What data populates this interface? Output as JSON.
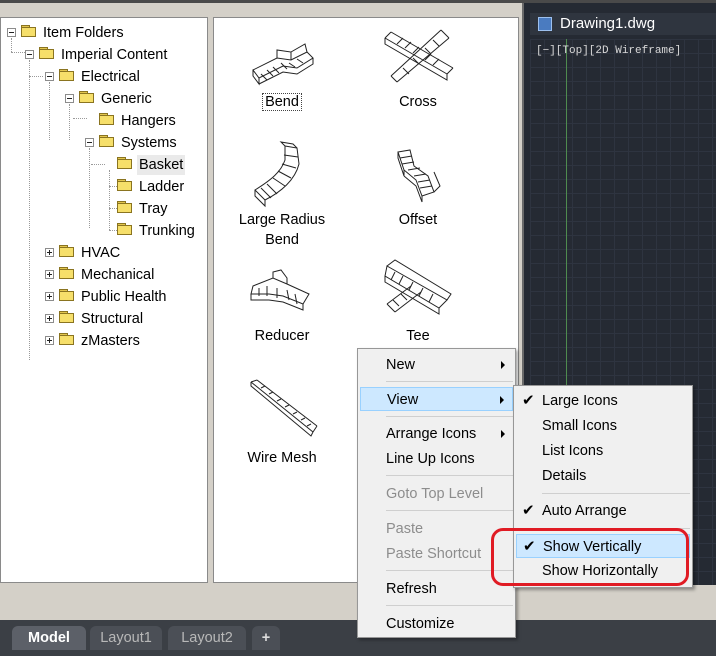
{
  "tree": {
    "root": "Item Folders",
    "imperial": "Imperial Content",
    "electrical": "Electrical",
    "generic": "Generic",
    "hangers": "Hangers",
    "systems": "Systems",
    "basket": "Basket",
    "ladder": "Ladder",
    "tray": "Tray",
    "trunking": "Trunking",
    "hvac": "HVAC",
    "mechanical": "Mechanical",
    "public_health": "Public Health",
    "structural": "Structural",
    "zmasters": "zMasters"
  },
  "icons": {
    "bend": "Bend",
    "cross": "Cross",
    "large_radius_bend_1": "Large Radius",
    "large_radius_bend_2": "Bend",
    "offset": "Offset",
    "reducer": "Reducer",
    "tee": "Tee",
    "wire_mesh": "Wire Mesh"
  },
  "drawing": {
    "tab_title": "Drawing1.dwg",
    "viewport_label": "[−][Top][2D Wireframe]"
  },
  "layout_tabs": {
    "model": "Model",
    "layout1": "Layout1",
    "layout2": "Layout2",
    "add": "+"
  },
  "context_menu": {
    "new": "New",
    "view": "View",
    "arrange_icons": "Arrange Icons",
    "line_up_icons": "Line Up Icons",
    "goto_top_level": "Goto Top Level",
    "paste": "Paste",
    "paste_shortcut": "Paste Shortcut",
    "refresh": "Refresh",
    "customize": "Customize"
  },
  "view_submenu": {
    "large_icons": "Large Icons",
    "small_icons": "Small Icons",
    "list_icons": "List Icons",
    "details": "Details",
    "auto_arrange": "Auto Arrange",
    "show_vertically": "Show Vertically",
    "show_horizontally": "Show Horizontally",
    "check_mark": "✔"
  },
  "colors": {
    "highlight": "#cde8ff",
    "annotation_red": "#e01b24",
    "folder_yellow": "#f6df6a",
    "drawing_bg": "#252a33"
  }
}
